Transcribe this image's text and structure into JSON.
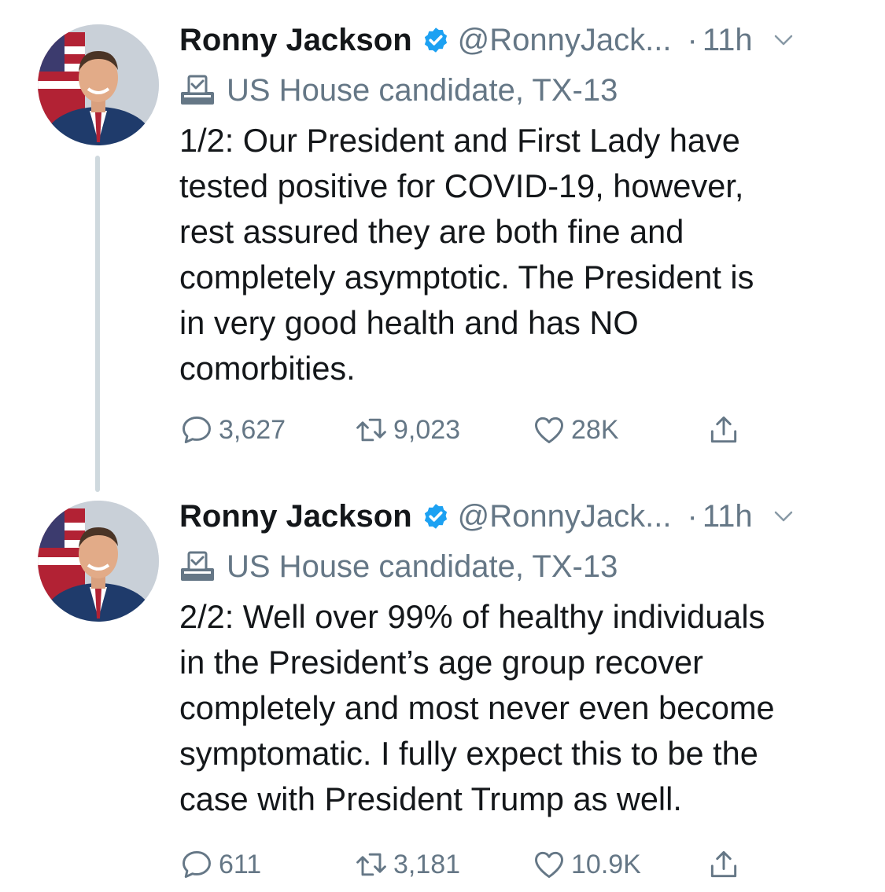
{
  "tweets": [
    {
      "author_name": "Ronny Jackson",
      "handle": "@RonnyJack...",
      "separator": "·",
      "time": "11h",
      "label": "US House candidate, TX-13",
      "text": "1/2: Our President and First Lady have\ntested positive for COVID-19, however,\nrest assured they are both fine and\ncompletely asymptotic. The President is\nin very good health and has NO\ncomorbities.",
      "replies": "3,627",
      "retweets": "9,023",
      "likes": "28K"
    },
    {
      "author_name": "Ronny Jackson",
      "handle": "@RonnyJack...",
      "separator": "·",
      "time": "11h",
      "label": "US House candidate, TX-13",
      "text": "2/2: Well over 99% of healthy individuals\nin the President’s age group recover\ncompletely and most never even become\nsymptomatic. I fully expect this to be the\ncase with President Trump as well.",
      "replies": "611",
      "retweets": "3,181",
      "likes": "10.9K"
    }
  ],
  "colors": {
    "text": "#14171a",
    "secondary": "#657786",
    "verified": "#1da1f2",
    "thread_line": "#cfd9de"
  }
}
